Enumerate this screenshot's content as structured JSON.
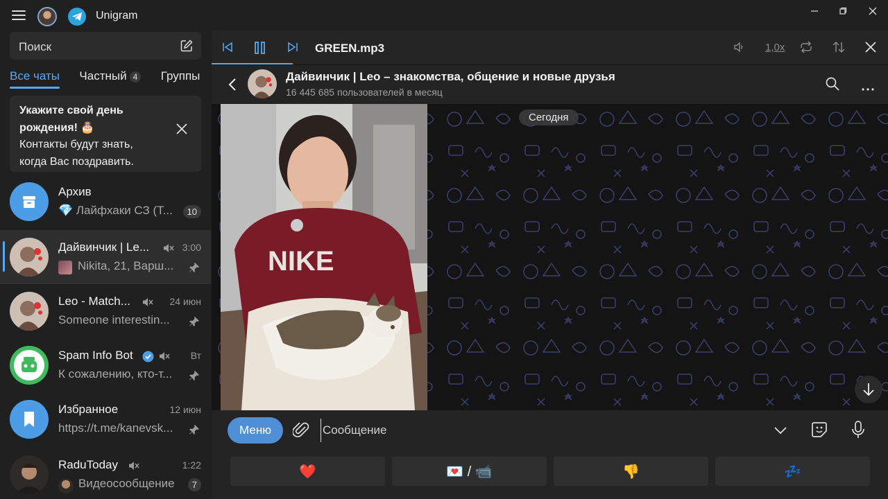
{
  "app": {
    "title": "Unigram"
  },
  "search": {
    "placeholder": "Поиск"
  },
  "tabs": [
    {
      "label": "Все чаты",
      "active": true
    },
    {
      "label": "Частный",
      "count": "4"
    },
    {
      "label": "Группы"
    }
  ],
  "birthday_prompt": {
    "line1": "Укажите свой день",
    "line2": "рождения! 🎂",
    "line3": "Контакты будут знать,",
    "line4": "когда Вас поздравить."
  },
  "chats": [
    {
      "name": "Архив",
      "preview": "💎 Лайфхаки СЗ (Т...",
      "badge": "10",
      "avatar": "archive-icon"
    },
    {
      "name": "Дайвинчик | Le...",
      "time": "3:00",
      "preview": "Nikita, 21, Варш...",
      "muted": true,
      "pinned": true,
      "selected": true
    },
    {
      "name": "Leo - Match...",
      "time": "24 июн",
      "preview": "Someone interestin...",
      "muted": true,
      "pinned": true
    },
    {
      "name": "Spam Info Bot",
      "time": "Вт",
      "preview": "К сожалению, кто-т...",
      "verified": true,
      "muted": true,
      "pinned": true
    },
    {
      "name": "Избранное",
      "time": "12 июн",
      "preview": "https://t.me/kanevsk...",
      "pinned": true,
      "avatar": "bookmark-icon"
    },
    {
      "name": "RaduToday",
      "time": "1:22",
      "preview": "Видеосообщение",
      "badge": "7",
      "muted": true
    }
  ],
  "player": {
    "track": "GREEN.mp3",
    "speed": "1,0x",
    "progress": 0.12
  },
  "chat_header": {
    "title": "Дайвинчик | Leo – знакомства, общение и новые друзья",
    "subtitle": "16 445 685 пользователей в месяц"
  },
  "chat_area": {
    "date": "Сегодня"
  },
  "composer": {
    "menu_label": "Меню",
    "placeholder": "Сообщение"
  },
  "keyboard": [
    {
      "label": "❤️"
    },
    {
      "label": "💌 / 📹"
    },
    {
      "label": "👎"
    },
    {
      "label": "💤"
    }
  ],
  "colors": {
    "accent": "#5aa9f0",
    "menu_button": "#4f8fd6",
    "background": "#1f1f1f"
  }
}
